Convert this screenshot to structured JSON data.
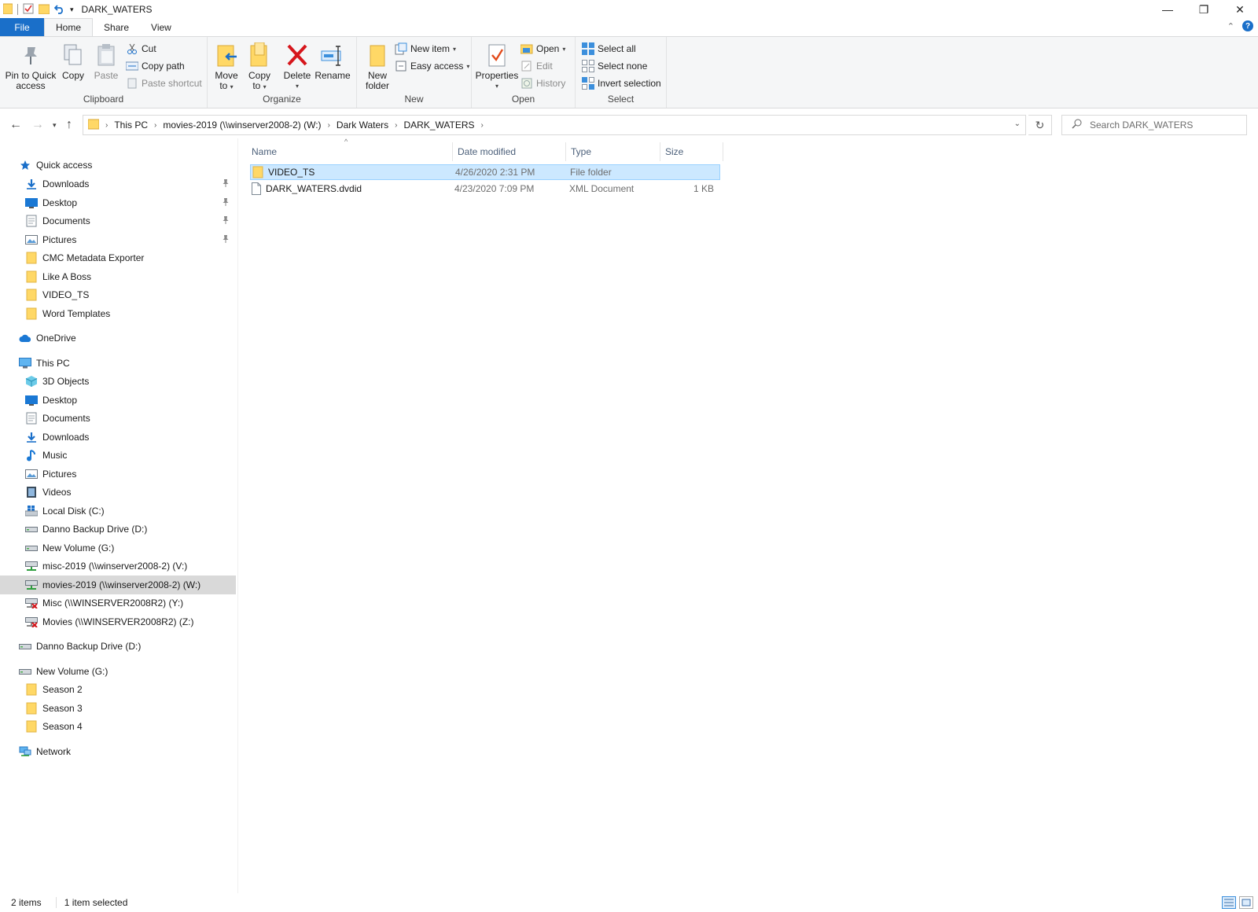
{
  "window": {
    "title": "DARK_WATERS",
    "minimize": "—",
    "restore": "❐",
    "close": "✕"
  },
  "tabs": {
    "file": "File",
    "home": "Home",
    "share": "Share",
    "view": "View",
    "collapse": "⌃",
    "help": "?"
  },
  "ribbon": {
    "clipboard": {
      "label": "Clipboard",
      "pin_line1": "Pin to Quick",
      "pin_line2": "access",
      "copy": "Copy",
      "paste": "Paste",
      "cut": "Cut",
      "copy_path": "Copy path",
      "paste_shortcut": "Paste shortcut"
    },
    "organize": {
      "label": "Organize",
      "move_line1": "Move",
      "move_line2": "to",
      "copy_line1": "Copy",
      "copy_line2": "to",
      "delete": "Delete",
      "rename": "Rename"
    },
    "new": {
      "label": "New",
      "folder_line1": "New",
      "folder_line2": "folder",
      "new_item": "New item",
      "easy_access": "Easy access"
    },
    "open": {
      "label": "Open",
      "properties": "Properties",
      "open": "Open",
      "edit": "Edit",
      "history": "History"
    },
    "select": {
      "label": "Select",
      "select_all": "Select all",
      "select_none": "Select none",
      "invert": "Invert selection"
    }
  },
  "address": {
    "crumbs": [
      "This PC",
      "movies-2019 (\\\\winserver2008-2) (W:)",
      "Dark Waters",
      "DARK_WATERS"
    ],
    "search_placeholder": "Search DARK_WATERS"
  },
  "nav": [
    {
      "label": "Quick access",
      "icon": "star-icon",
      "level": 0,
      "pinned": false
    },
    {
      "label": "Downloads",
      "icon": "download-arrow-icon",
      "level": 1,
      "pinned": true
    },
    {
      "label": "Desktop",
      "icon": "desktop-icon",
      "level": 1,
      "pinned": true
    },
    {
      "label": "Documents",
      "icon": "documents-icon",
      "level": 1,
      "pinned": true
    },
    {
      "label": "Pictures",
      "icon": "pictures-icon",
      "level": 1,
      "pinned": true
    },
    {
      "label": "CMC Metadata Exporter",
      "icon": "folder-icon",
      "level": 1,
      "pinned": false
    },
    {
      "label": "Like A Boss",
      "icon": "folder-icon",
      "level": 1,
      "pinned": false
    },
    {
      "label": "VIDEO_TS",
      "icon": "folder-icon",
      "level": 1,
      "pinned": false
    },
    {
      "label": "Word Templates",
      "icon": "folder-icon",
      "level": 1,
      "pinned": false
    },
    {
      "label": "OneDrive",
      "icon": "cloud-icon",
      "level": 0,
      "pinned": false
    },
    {
      "label": "This PC",
      "icon": "computer-icon",
      "level": 0,
      "pinned": false
    },
    {
      "label": "3D Objects",
      "icon": "cube-icon",
      "level": 1,
      "pinned": false
    },
    {
      "label": "Desktop",
      "icon": "desktop-icon",
      "level": 1,
      "pinned": false
    },
    {
      "label": "Documents",
      "icon": "documents-icon",
      "level": 1,
      "pinned": false
    },
    {
      "label": "Downloads",
      "icon": "download-arrow-icon",
      "level": 1,
      "pinned": false
    },
    {
      "label": "Music",
      "icon": "music-note-icon",
      "level": 1,
      "pinned": false
    },
    {
      "label": "Pictures",
      "icon": "pictures-icon",
      "level": 1,
      "pinned": false
    },
    {
      "label": "Videos",
      "icon": "video-icon",
      "level": 1,
      "pinned": false
    },
    {
      "label": "Local Disk (C:)",
      "icon": "windows-drive-icon",
      "level": 1,
      "pinned": false
    },
    {
      "label": "Danno Backup Drive (D:)",
      "icon": "drive-icon",
      "level": 1,
      "pinned": false
    },
    {
      "label": "New Volume (G:)",
      "icon": "drive-icon",
      "level": 1,
      "pinned": false
    },
    {
      "label": "misc-2019 (\\\\winserver2008-2) (V:)",
      "icon": "network-drive-icon",
      "level": 1,
      "pinned": false
    },
    {
      "label": "movies-2019 (\\\\winserver2008-2) (W:)",
      "icon": "network-drive-icon",
      "level": 1,
      "pinned": false,
      "selected": true
    },
    {
      "label": "Misc (\\\\WINSERVER2008R2) (Y:)",
      "icon": "disconnected-drive-icon",
      "level": 1,
      "pinned": false
    },
    {
      "label": "Movies (\\\\WINSERVER2008R2) (Z:)",
      "icon": "disconnected-drive-icon",
      "level": 1,
      "pinned": false
    },
    {
      "label": "Danno Backup Drive (D:)",
      "icon": "drive-icon",
      "level": 0,
      "pinned": false
    },
    {
      "label": "New Volume (G:)",
      "icon": "drive-icon",
      "level": 0,
      "pinned": false
    },
    {
      "label": "Season 2",
      "icon": "folder-icon",
      "level": 1,
      "pinned": false
    },
    {
      "label": "Season 3",
      "icon": "folder-icon",
      "level": 1,
      "pinned": false
    },
    {
      "label": "Season 4",
      "icon": "folder-icon",
      "level": 1,
      "pinned": false
    },
    {
      "label": "Network",
      "icon": "network-icon",
      "level": 0,
      "pinned": false
    }
  ],
  "columns": {
    "name": "Name",
    "date": "Date modified",
    "type": "Type",
    "size": "Size"
  },
  "files": [
    {
      "name": "VIDEO_TS",
      "date": "4/26/2020 2:31 PM",
      "type": "File folder",
      "size": "",
      "icon": "folder-icon",
      "selected": true
    },
    {
      "name": "DARK_WATERS.dvdid",
      "date": "4/23/2020 7:09 PM",
      "type": "XML Document",
      "size": "1 KB",
      "icon": "file-icon",
      "selected": false
    }
  ],
  "status": {
    "count": "2 items",
    "selected": "1 item selected"
  },
  "colors": {
    "accent": "#1a6fc9",
    "selection": "#cce8ff",
    "folder": "#ffd866"
  }
}
